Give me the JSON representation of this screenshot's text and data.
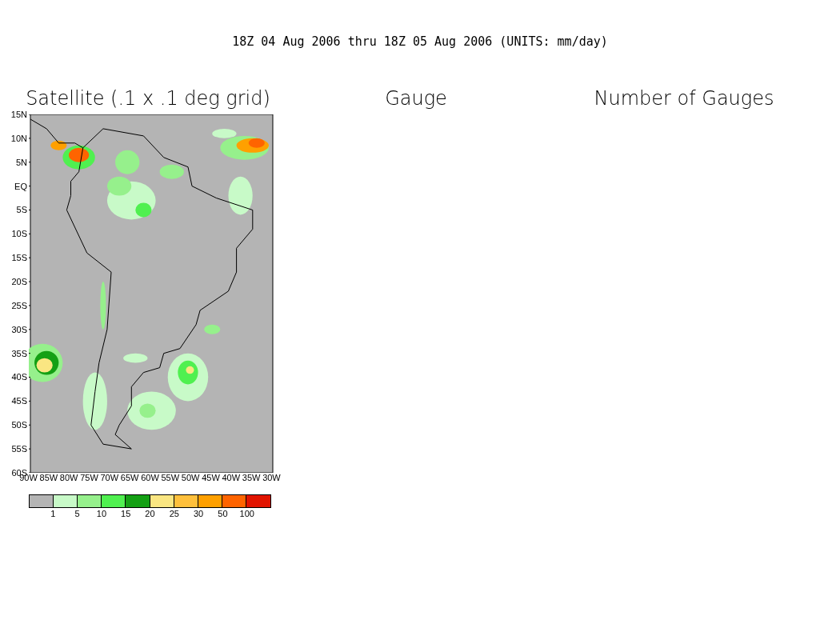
{
  "title": "18Z 04 Aug 2006 thru 18Z 05 Aug 2006 (UNITS: mm/day)",
  "panels": [
    {
      "title": "Satellite (.1 x .1 deg grid)"
    },
    {
      "title": "Gauge"
    },
    {
      "title": "Number of Gauges"
    }
  ],
  "map": {
    "y_ticks": [
      "15N",
      "10N",
      "5N",
      "EQ",
      "5S",
      "10S",
      "15S",
      "20S",
      "25S",
      "30S",
      "35S",
      "40S",
      "45S",
      "50S",
      "55S",
      "60S"
    ],
    "x_ticks": [
      "90W",
      "85W",
      "80W",
      "75W",
      "70W",
      "65W",
      "60W",
      "55W",
      "50W",
      "45W",
      "40W",
      "35W",
      "30W"
    ]
  },
  "legend": {
    "bins": [
      {
        "color": "#b4b4b4"
      },
      {
        "color": "#c8fac8"
      },
      {
        "color": "#96f08c"
      },
      {
        "color": "#50f050"
      },
      {
        "color": "#14a014"
      },
      {
        "color": "#fae682"
      },
      {
        "color": "#ffc03c"
      },
      {
        "color": "#ffa000"
      },
      {
        "color": "#ff6400"
      },
      {
        "color": "#e11400"
      }
    ],
    "labels": [
      "1",
      "5",
      "10",
      "15",
      "20",
      "25",
      "30",
      "50",
      "100"
    ]
  }
}
